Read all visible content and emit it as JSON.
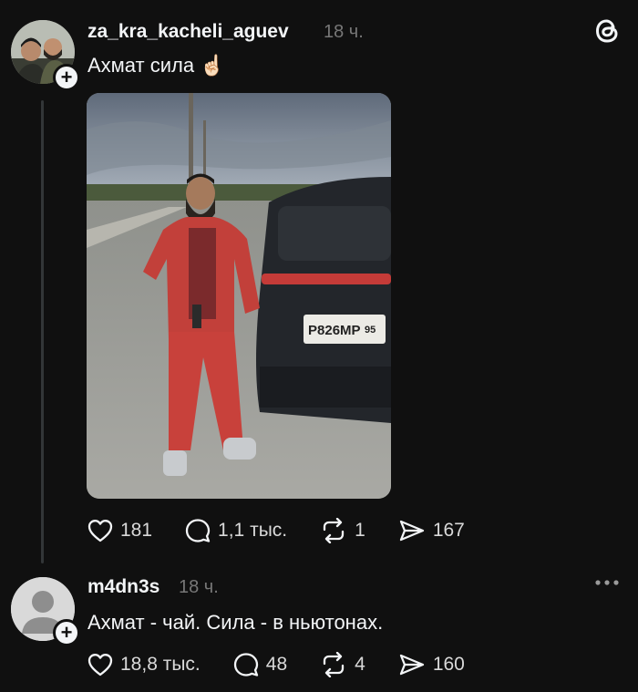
{
  "post": {
    "username": "za_kra_kacheli_aguev",
    "time": "18 ч.",
    "text": "Ахмат сила ☝🏻",
    "likes": "181",
    "comments": "1,1 тыс.",
    "reposts": "1",
    "shares": "167",
    "plate_text": "P826MP",
    "plate_region": "95"
  },
  "reply": {
    "username": "m4dn3s",
    "time": "18 ч.",
    "text": "Ахмат - чай. Сила - в ньютонах.",
    "likes": "18,8 тыс.",
    "comments": "48",
    "reposts": "4",
    "shares": "160"
  },
  "icons": {
    "app_logo": "threads-icon",
    "more": "more-horizontal-icon",
    "like": "heart-icon",
    "comment": "comment-bubble-icon",
    "repost": "repost-icon",
    "share": "send-icon"
  },
  "colors": {
    "background": "#101010",
    "text": "#f3f5f7",
    "muted": "#777777",
    "thread_line": "#333638"
  }
}
